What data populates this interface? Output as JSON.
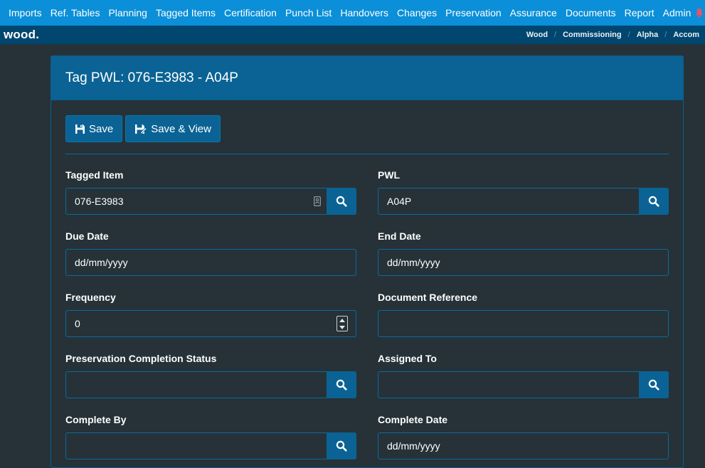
{
  "nav": {
    "items": [
      "Imports",
      "Ref. Tables",
      "Planning",
      "Tagged Items",
      "Certification",
      "Punch List",
      "Handovers",
      "Changes",
      "Preservation",
      "Assurance",
      "Documents",
      "Report",
      "Admin"
    ],
    "help_label": "?"
  },
  "brand": {
    "logo": "wood",
    "logo_dot": "."
  },
  "breadcrumb": [
    "Wood",
    "Commissioning",
    "Alpha",
    "Accom"
  ],
  "page": {
    "title": "Tag PWL: 076-E3983 - A04P"
  },
  "toolbar": {
    "save_label": "Save",
    "save_view_label": "Save & View"
  },
  "form": {
    "tagged_item": {
      "label": "Tagged Item",
      "value": "076-E3983"
    },
    "pwl": {
      "label": "PWL",
      "value": "A04P"
    },
    "due_date": {
      "label": "Due Date",
      "value": "dd/mm/yyyy"
    },
    "end_date": {
      "label": "End Date",
      "value": "dd/mm/yyyy"
    },
    "frequency": {
      "label": "Frequency",
      "value": "0"
    },
    "document_reference": {
      "label": "Document Reference",
      "value": ""
    },
    "preservation_completion_status": {
      "label": "Preservation Completion Status",
      "value": ""
    },
    "assigned_to": {
      "label": "Assigned To",
      "value": ""
    },
    "complete_by": {
      "label": "Complete By",
      "value": ""
    },
    "complete_date": {
      "label": "Complete Date",
      "value": "dd/mm/yyyy"
    }
  },
  "colors": {
    "topnav": "#0b8fd8",
    "subbar": "#01466f",
    "accent": "#0a6394",
    "background": "#263238",
    "bell": "#e5546a"
  }
}
